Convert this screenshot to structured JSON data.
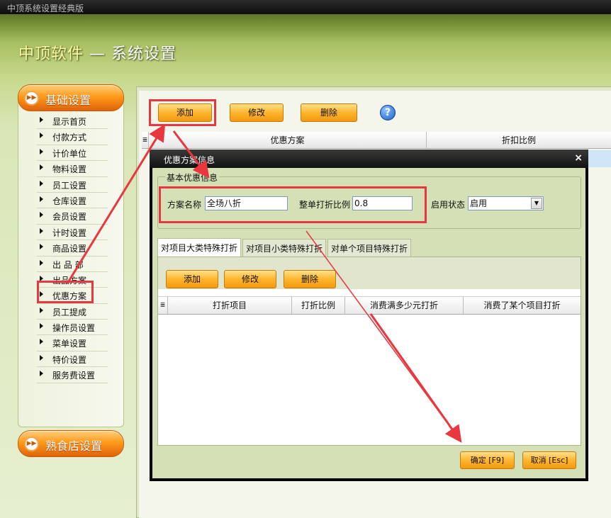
{
  "window": {
    "title": "中顶系统设置经典版"
  },
  "header": {
    "brand": "中顶软件",
    "separator": " — ",
    "section": "系统设置"
  },
  "sidebar": {
    "groups": [
      {
        "label": "基础设置"
      },
      {
        "label": "熟食店设置"
      }
    ],
    "items": [
      "显示首页",
      "付款方式",
      "计价单位",
      "物料设置",
      "员工设置",
      "仓库设置",
      "会员设置",
      "计时设置",
      "商品设置",
      "出 品 部",
      "出品方案",
      "优惠方案",
      "员工提成",
      "操作员设置",
      "菜单设置",
      "特价设置",
      "服务费设置"
    ],
    "selected": "优惠方案"
  },
  "toolbar": {
    "add": "添加",
    "edit": "修改",
    "delete": "删除",
    "help": "?"
  },
  "main_grid": {
    "columns": [
      "优惠方案",
      "折扣比例"
    ]
  },
  "dialog": {
    "title": "优惠方案信息",
    "close": "×",
    "group_title": "基本优惠信息",
    "fields": {
      "name_label": "方案名称",
      "name_value": "全场八折",
      "ratio_label": "整单打折比例",
      "ratio_value": "0.8",
      "status_label": "启用状态",
      "status_value": "启用"
    },
    "tabs": [
      "对项目大类特殊打折",
      "对项目小类特殊打折",
      "对单个项目特殊打折"
    ],
    "active_tab": 0,
    "inner_toolbar": {
      "add": "添加",
      "edit": "修改",
      "delete": "删除"
    },
    "inner_grid": {
      "columns": [
        "打折项目",
        "打折比例",
        "消费满多少元打折",
        "消费了某个项目打折"
      ]
    },
    "ok": "确定 [F9]",
    "cancel": "取消 [Esc]"
  },
  "colors": {
    "highlight": "#e8373f",
    "button": "#ffb52e",
    "accent_orange": "#ff9a1a"
  }
}
